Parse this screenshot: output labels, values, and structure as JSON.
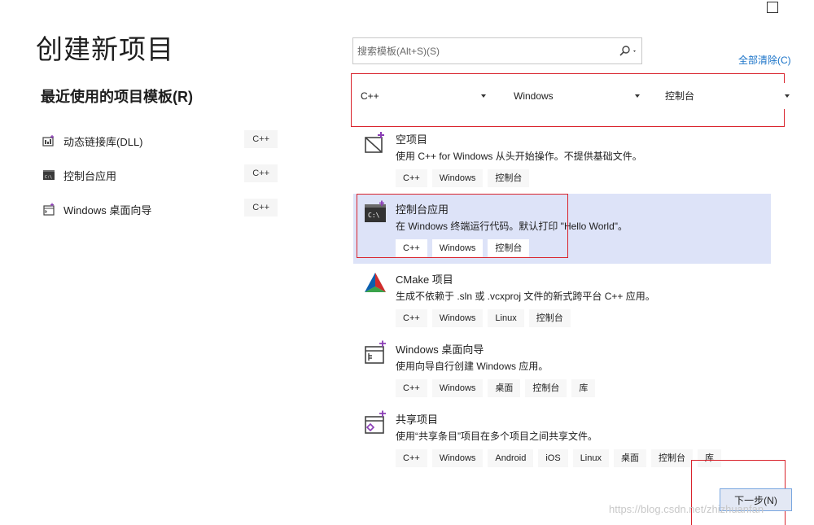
{
  "page": {
    "title": "创建新项目",
    "recent_title": "最近使用的项目模板(R)"
  },
  "recent": [
    {
      "label": "动态链接库(DLL)",
      "tag": "C++",
      "icon": "dll-template-icon"
    },
    {
      "label": "控制台应用",
      "tag": "C++",
      "icon": "console-app-icon"
    },
    {
      "label": "Windows 桌面向导",
      "tag": "C++",
      "icon": "desktop-wizard-icon"
    }
  ],
  "search": {
    "placeholder": "搜索模板(Alt+S)(S)",
    "icon": "search-icon"
  },
  "clear_all": "全部清除(C)",
  "filters": {
    "language": "C++",
    "platform": "Windows",
    "project_type": "控制台"
  },
  "templates": [
    {
      "name": "空项目",
      "desc": "使用 C++ for Windows 从头开始操作。不提供基础文件。",
      "tags": [
        "C++",
        "Windows",
        "控制台"
      ],
      "icon": "empty-project-icon"
    },
    {
      "name": "控制台应用",
      "desc": "在 Windows 终端运行代码。默认打印 \"Hello World\"。",
      "tags": [
        "C++",
        "Windows",
        "控制台"
      ],
      "icon": "console-app-icon",
      "selected": true
    },
    {
      "name": "CMake 项目",
      "desc": "生成不依赖于 .sln 或 .vcxproj 文件的新式跨平台 C++ 应用。",
      "tags": [
        "C++",
        "Windows",
        "Linux",
        "控制台"
      ],
      "icon": "cmake-icon"
    },
    {
      "name": "Windows 桌面向导",
      "desc": "使用向导自行创建 Windows 应用。",
      "tags": [
        "C++",
        "Windows",
        "桌面",
        "控制台",
        "库"
      ],
      "icon": "desktop-wizard-icon"
    },
    {
      "name": "共享项目",
      "desc": "使用“共享条目”项目在多个项目之间共享文件。",
      "tags": [
        "C++",
        "Windows",
        "Android",
        "iOS",
        "Linux",
        "桌面",
        "控制台",
        "库"
      ],
      "icon": "shared-project-icon"
    }
  ],
  "next_button": "下一步(N)",
  "watermark": "https://blog.csdn.net/zhizhuanfan"
}
